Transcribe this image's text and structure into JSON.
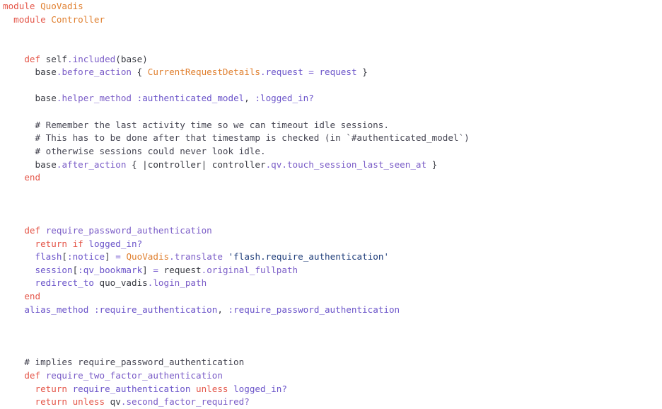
{
  "editor": {
    "language": "ruby",
    "background": "#ffffff",
    "font_size_px": 12.6,
    "line_height_px": 18.65,
    "colors": {
      "keyword": "#e45649",
      "constant": "#e08030",
      "plain": "#383a42",
      "method": "#7a5cc7",
      "symbol": "#6a53c9",
      "punctuation": "#7b5fd1",
      "string": "#1f3d7a",
      "comment": "#454552"
    }
  },
  "code": {
    "lines": [
      {
        "indent": 0,
        "tokens": [
          {
            "t": "module",
            "c": "kw"
          },
          {
            "t": " ",
            "c": "plain"
          },
          {
            "t": "QuoVadis",
            "c": "const"
          }
        ]
      },
      {
        "indent": 1,
        "tokens": [
          {
            "t": "module",
            "c": "kw"
          },
          {
            "t": " ",
            "c": "plain"
          },
          {
            "t": "Controller",
            "c": "const"
          }
        ]
      },
      {
        "indent": 0,
        "tokens": []
      },
      {
        "indent": 0,
        "tokens": []
      },
      {
        "indent": 2,
        "tokens": [
          {
            "t": "def",
            "c": "kw"
          },
          {
            "t": " self",
            "c": "plain"
          },
          {
            "t": ".",
            "c": "punct"
          },
          {
            "t": "included",
            "c": "method"
          },
          {
            "t": "(base)",
            "c": "plain"
          }
        ]
      },
      {
        "indent": 3,
        "tokens": [
          {
            "t": "base",
            "c": "plain"
          },
          {
            "t": ".",
            "c": "punct"
          },
          {
            "t": "before_action",
            "c": "method"
          },
          {
            "t": " { ",
            "c": "plain"
          },
          {
            "t": "CurrentRequestDetails",
            "c": "const"
          },
          {
            "t": ".",
            "c": "punct"
          },
          {
            "t": "request",
            "c": "sym"
          },
          {
            "t": " ",
            "c": "plain"
          },
          {
            "t": "=",
            "c": "punct"
          },
          {
            "t": " ",
            "c": "plain"
          },
          {
            "t": "request",
            "c": "sym"
          },
          {
            "t": " }",
            "c": "plain"
          }
        ]
      },
      {
        "indent": 0,
        "tokens": []
      },
      {
        "indent": 3,
        "tokens": [
          {
            "t": "base",
            "c": "plain"
          },
          {
            "t": ".",
            "c": "punct"
          },
          {
            "t": "helper_method",
            "c": "method"
          },
          {
            "t": " ",
            "c": "plain"
          },
          {
            "t": ":authenticated_model",
            "c": "sym"
          },
          {
            "t": ", ",
            "c": "plain"
          },
          {
            "t": ":logged_in?",
            "c": "sym"
          }
        ]
      },
      {
        "indent": 0,
        "tokens": []
      },
      {
        "indent": 3,
        "tokens": [
          {
            "t": "# Remember the last activity time so we can timeout idle sessions.",
            "c": "comment"
          }
        ]
      },
      {
        "indent": 3,
        "tokens": [
          {
            "t": "# This has to be done after that timestamp is checked (in `#authenticated_model`)",
            "c": "comment"
          }
        ]
      },
      {
        "indent": 3,
        "tokens": [
          {
            "t": "# otherwise sessions could never look idle.",
            "c": "comment"
          }
        ]
      },
      {
        "indent": 3,
        "tokens": [
          {
            "t": "base",
            "c": "plain"
          },
          {
            "t": ".",
            "c": "punct"
          },
          {
            "t": "after_action",
            "c": "method"
          },
          {
            "t": " { |controller| controller",
            "c": "plain"
          },
          {
            "t": ".",
            "c": "punct"
          },
          {
            "t": "qv",
            "c": "method"
          },
          {
            "t": ".",
            "c": "punct"
          },
          {
            "t": "touch_session_last_seen_at",
            "c": "method"
          },
          {
            "t": " }",
            "c": "plain"
          }
        ]
      },
      {
        "indent": 2,
        "tokens": [
          {
            "t": "end",
            "c": "kw"
          }
        ]
      },
      {
        "indent": 0,
        "tokens": []
      },
      {
        "indent": 0,
        "tokens": []
      },
      {
        "indent": 0,
        "tokens": []
      },
      {
        "indent": 2,
        "tokens": [
          {
            "t": "def",
            "c": "kw"
          },
          {
            "t": " ",
            "c": "plain"
          },
          {
            "t": "require_password_authentication",
            "c": "method"
          }
        ]
      },
      {
        "indent": 3,
        "tokens": [
          {
            "t": "return",
            "c": "kw"
          },
          {
            "t": " ",
            "c": "plain"
          },
          {
            "t": "if",
            "c": "kw"
          },
          {
            "t": " ",
            "c": "plain"
          },
          {
            "t": "logged_in?",
            "c": "sym"
          }
        ]
      },
      {
        "indent": 3,
        "tokens": [
          {
            "t": "flash",
            "c": "sym"
          },
          {
            "t": "[",
            "c": "plain"
          },
          {
            "t": ":notice",
            "c": "sym"
          },
          {
            "t": "]",
            "c": "plain"
          },
          {
            "t": " ",
            "c": "plain"
          },
          {
            "t": "=",
            "c": "punct"
          },
          {
            "t": " ",
            "c": "plain"
          },
          {
            "t": "QuoVadis",
            "c": "const"
          },
          {
            "t": ".",
            "c": "punct"
          },
          {
            "t": "translate",
            "c": "method"
          },
          {
            "t": " ",
            "c": "plain"
          },
          {
            "t": "'flash.require_authentication'",
            "c": "string"
          }
        ]
      },
      {
        "indent": 3,
        "tokens": [
          {
            "t": "session",
            "c": "sym"
          },
          {
            "t": "[",
            "c": "plain"
          },
          {
            "t": ":qv_bookmark",
            "c": "sym"
          },
          {
            "t": "]",
            "c": "plain"
          },
          {
            "t": " ",
            "c": "plain"
          },
          {
            "t": "=",
            "c": "punct"
          },
          {
            "t": " request",
            "c": "plain"
          },
          {
            "t": ".",
            "c": "punct"
          },
          {
            "t": "original_fullpath",
            "c": "method"
          }
        ]
      },
      {
        "indent": 3,
        "tokens": [
          {
            "t": "redirect_to",
            "c": "sym"
          },
          {
            "t": " quo_vadis",
            "c": "plain"
          },
          {
            "t": ".",
            "c": "punct"
          },
          {
            "t": "login_path",
            "c": "method"
          }
        ]
      },
      {
        "indent": 2,
        "tokens": [
          {
            "t": "end",
            "c": "kw"
          }
        ]
      },
      {
        "indent": 2,
        "tokens": [
          {
            "t": "alias_method",
            "c": "sym"
          },
          {
            "t": " ",
            "c": "plain"
          },
          {
            "t": ":require_authentication",
            "c": "sym"
          },
          {
            "t": ", ",
            "c": "plain"
          },
          {
            "t": ":require_password_authentication",
            "c": "sym"
          }
        ]
      },
      {
        "indent": 0,
        "tokens": []
      },
      {
        "indent": 0,
        "tokens": []
      },
      {
        "indent": 0,
        "tokens": []
      },
      {
        "indent": 2,
        "tokens": [
          {
            "t": "# implies require_password_authentication",
            "c": "comment"
          }
        ]
      },
      {
        "indent": 2,
        "tokens": [
          {
            "t": "def",
            "c": "kw"
          },
          {
            "t": " ",
            "c": "plain"
          },
          {
            "t": "require_two_factor_authentication",
            "c": "method"
          }
        ]
      },
      {
        "indent": 3,
        "tokens": [
          {
            "t": "return",
            "c": "kw"
          },
          {
            "t": " ",
            "c": "plain"
          },
          {
            "t": "require_authentication",
            "c": "sym"
          },
          {
            "t": " ",
            "c": "plain"
          },
          {
            "t": "unless",
            "c": "kw"
          },
          {
            "t": " ",
            "c": "plain"
          },
          {
            "t": "logged_in?",
            "c": "sym"
          }
        ]
      },
      {
        "indent": 3,
        "tokens": [
          {
            "t": "return",
            "c": "kw"
          },
          {
            "t": " ",
            "c": "plain"
          },
          {
            "t": "unless",
            "c": "kw"
          },
          {
            "t": " qv",
            "c": "plain"
          },
          {
            "t": ".",
            "c": "punct"
          },
          {
            "t": "second_factor_required?",
            "c": "method"
          }
        ]
      }
    ]
  }
}
